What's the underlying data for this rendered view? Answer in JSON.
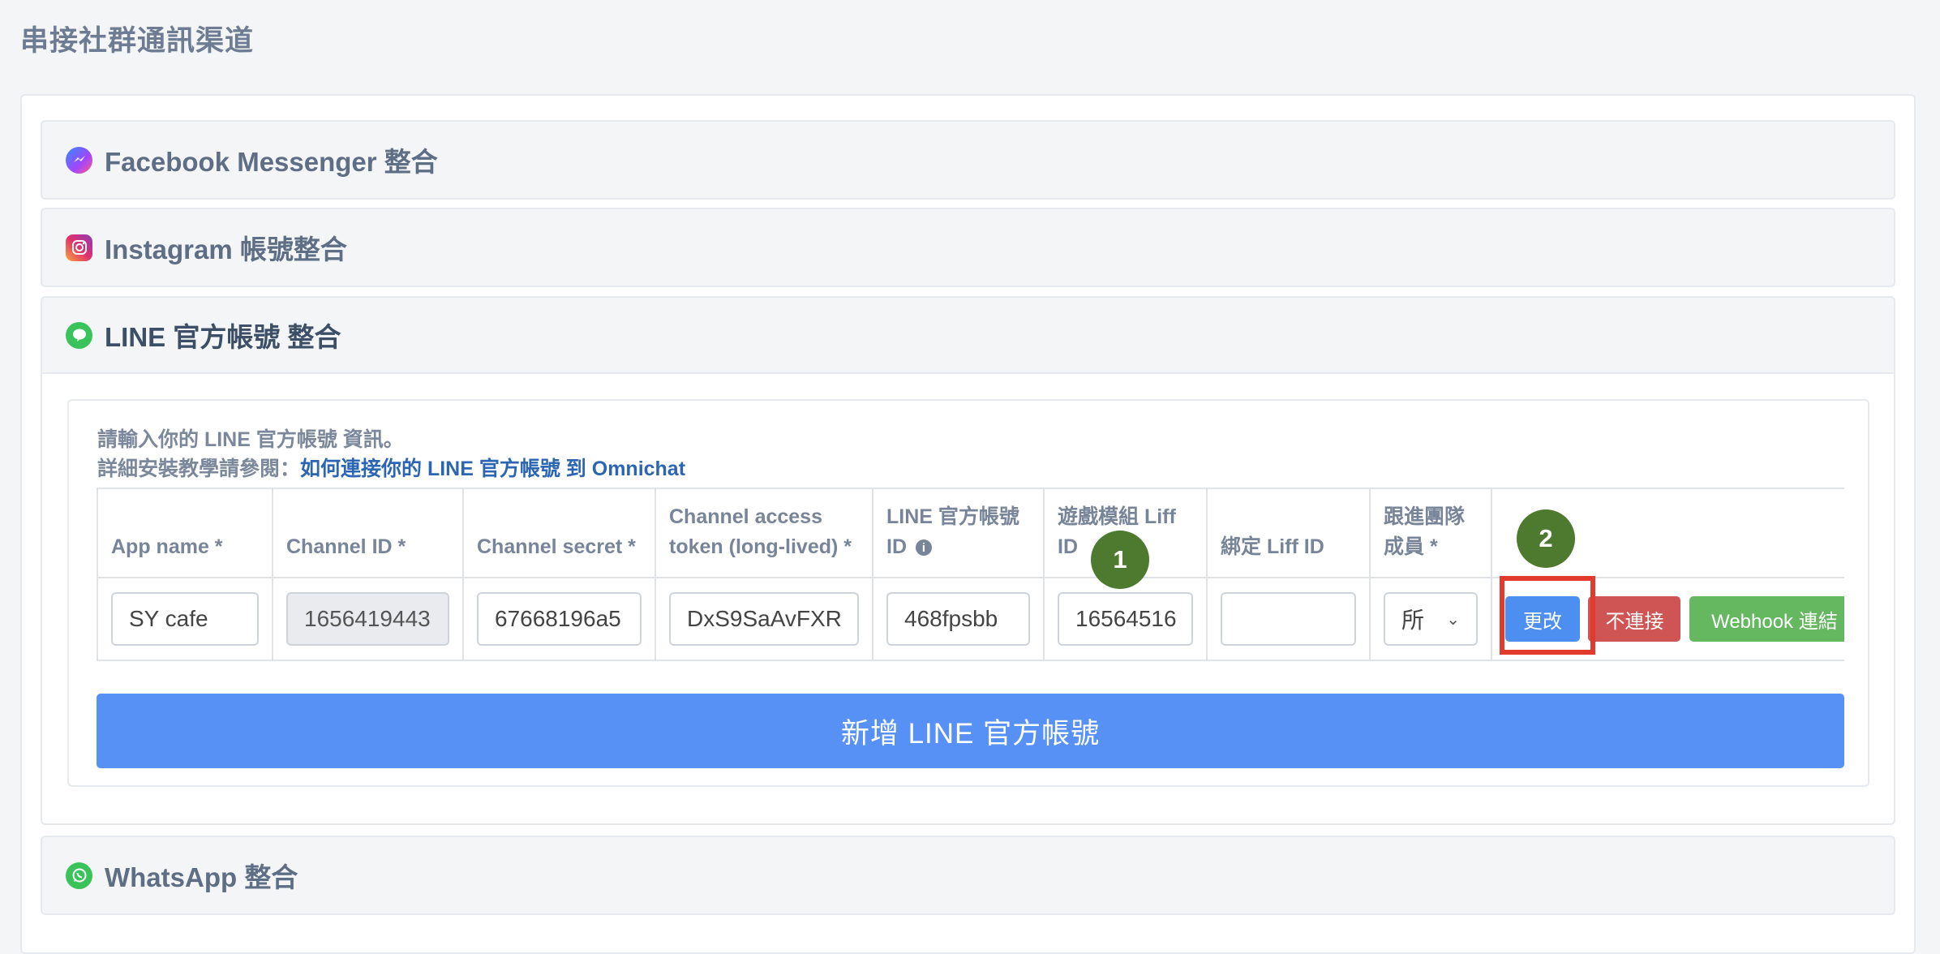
{
  "page_title": "串接社群通訊渠道",
  "panels": {
    "facebook": "Facebook Messenger 整合",
    "instagram": "Instagram 帳號整合",
    "line": "LINE 官方帳號 整合",
    "whatsapp": "WhatsApp 整合"
  },
  "line_form": {
    "intro_line1": "請輸入你的 LINE 官方帳號 資訊。",
    "intro_line2_prefix": "詳細安裝教學請參閱：",
    "intro_link": "如何連接你的 LINE 官方帳號 到 Omnichat",
    "columns": [
      "App name *",
      "Channel ID *",
      "Channel secret *",
      "Channel access token (long-lived) *",
      "LINE 官方帳號 ID",
      "遊戲模組 Liff ID",
      "綁定 Liff ID",
      "跟進團隊成員 *"
    ],
    "row": {
      "app_name": "SY cafe",
      "channel_id": "1656419443",
      "channel_secret": "67668196a5",
      "access_token": "DxS9SaAvFXR",
      "official_id": "468fpsbb",
      "game_liff_id": "16564516",
      "bind_liff_id": "",
      "team_member": "所"
    },
    "buttons": {
      "update": "更改",
      "disconnect": "不連接",
      "webhook": "Webhook 連結"
    },
    "add_button": "新增 LINE 官方帳號"
  },
  "badges": [
    "1",
    "2"
  ],
  "colors": {
    "primary_blue": "#5791f6",
    "danger_red": "#cf5554",
    "success_green": "#66b860",
    "badge_green": "#4d7a2f",
    "highlight_red": "#e23b2e"
  }
}
